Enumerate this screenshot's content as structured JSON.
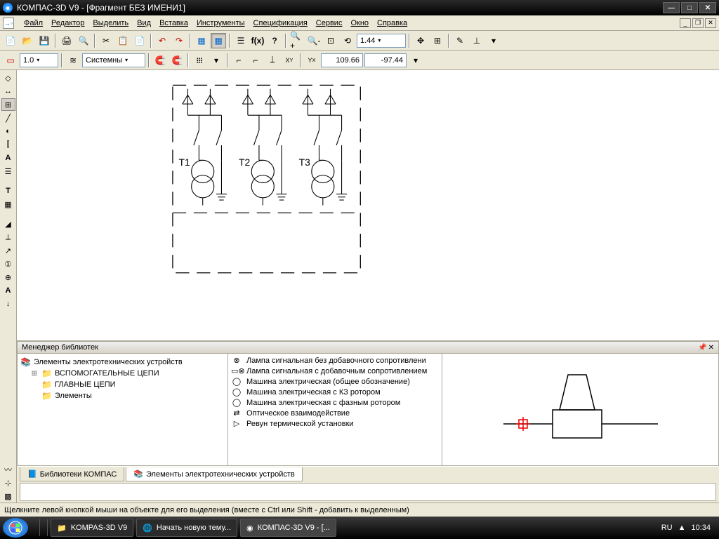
{
  "titlebar": {
    "text": "КОМПАС-3D V9 - [Фрагмент БЕЗ ИМЕНИ1]"
  },
  "menu": {
    "items": [
      "Файл",
      "Редактор",
      "Выделить",
      "Вид",
      "Вставка",
      "Инструменты",
      "Спецификация",
      "Сервис",
      "Окно",
      "Справка"
    ]
  },
  "toolbar2": {
    "zoom": "1.44"
  },
  "toolbar3": {
    "scale": "1.0",
    "linestyle": "Системны",
    "coord_x": "109.66",
    "coord_y": "-97.44"
  },
  "drawing": {
    "labels": [
      "T1",
      "T2",
      "T3"
    ]
  },
  "library": {
    "panel_title": "Менеджер библиотек",
    "tree": {
      "root": "Элементы электротехнических устройств",
      "children": [
        "ВСПОМОГАТЕЛЬНЫЕ ЦЕПИ",
        "ГЛАВНЫЕ ЦЕПИ",
        "Элементы"
      ]
    },
    "list": [
      "Лампа сигнальная без добавочного сопротивлени",
      "Лампа сигнальная с добавочным сопротивлением",
      "Машина электрическая (общее обозначение)",
      "Машина электрическая с КЗ ротором",
      "Машина электрическая с фазным ротором",
      "Оптическое взаимодействие",
      "Ревун термической установки"
    ],
    "tabs": [
      "Библиотеки КОМПАС",
      "Элементы электротехнических устройств"
    ]
  },
  "status": {
    "text": "Щелкните левой кнопкой мыши на объекте для его выделения (вместе с Ctrl или Shift - добавить к выделенным)"
  },
  "taskbar": {
    "items": [
      "KOMPAS-3D V9",
      "Начать новую тему...",
      "КОМПАС-3D V9 - [..."
    ],
    "lang": "RU",
    "time": "10:34"
  }
}
